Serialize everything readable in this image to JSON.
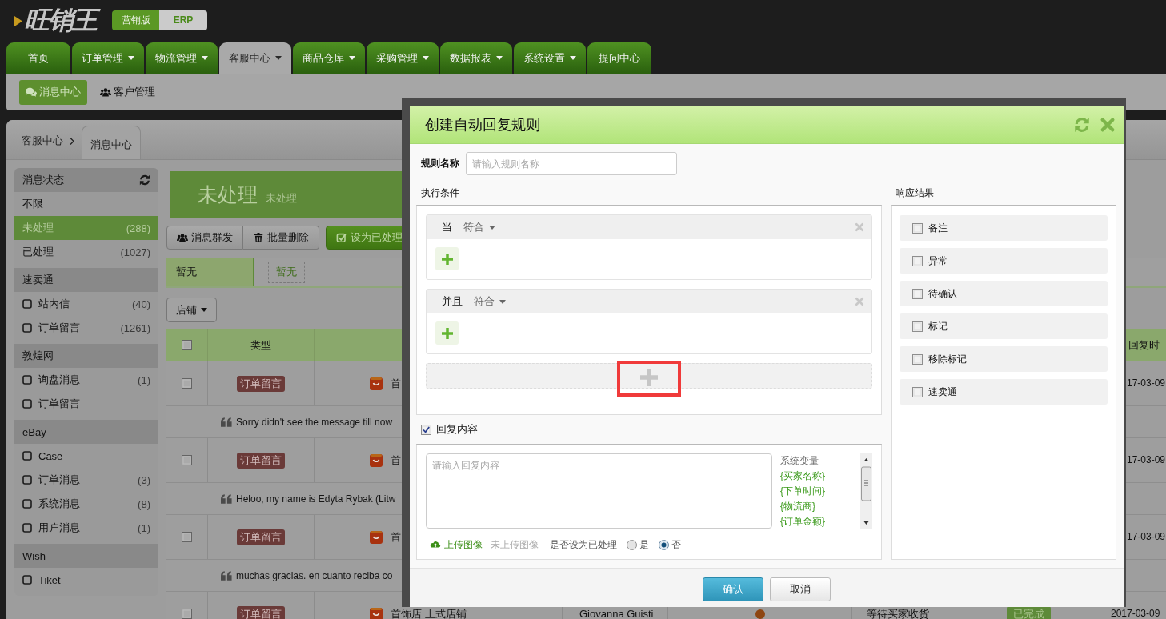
{
  "header": {
    "logo": "旺销王",
    "edition_switch": [
      {
        "label": "营销版",
        "selected": false
      },
      {
        "label": "ERP",
        "selected": true
      }
    ]
  },
  "nav_tabs": [
    {
      "label": "首页",
      "dropdown": false,
      "selected": false
    },
    {
      "label": "订单管理",
      "dropdown": true,
      "selected": false
    },
    {
      "label": "物流管理",
      "dropdown": true,
      "selected": false
    },
    {
      "label": "客服中心",
      "dropdown": true,
      "selected": true
    },
    {
      "label": "商品仓库",
      "dropdown": true,
      "selected": false
    },
    {
      "label": "采购管理",
      "dropdown": true,
      "selected": false
    },
    {
      "label": "数据报表",
      "dropdown": true,
      "selected": false
    },
    {
      "label": "系统设置",
      "dropdown": true,
      "selected": false
    },
    {
      "label": "提问中心",
      "dropdown": false,
      "selected": false
    }
  ],
  "sub_nav": [
    {
      "label": "消息中心",
      "selected": true
    },
    {
      "label": "客户管理",
      "selected": false
    }
  ],
  "breadcrumb": {
    "parent": "客服中心",
    "current_tab": "消息中心"
  },
  "sidebar": {
    "groups": [
      {
        "kind": "status",
        "title": "消息状态",
        "items": [
          {
            "label": "不限",
            "selected": false
          },
          {
            "label": "未处理",
            "count": "(288)",
            "selected": true
          },
          {
            "label": "已处理",
            "count": "(1027)",
            "selected": false
          }
        ]
      },
      {
        "kind": "platform",
        "title": "速卖通",
        "items": [
          {
            "label": "站内信",
            "count": "(40)",
            "checked": false
          },
          {
            "label": "订单留言",
            "count": "(1261)",
            "checked": false
          }
        ]
      },
      {
        "kind": "platform",
        "title": "敦煌网",
        "items": [
          {
            "label": "询盘消息",
            "count": "(1)",
            "checked": false
          },
          {
            "label": "订单留言",
            "checked": false
          }
        ]
      },
      {
        "kind": "platform",
        "title": "eBay",
        "items": [
          {
            "label": "Case",
            "checked": false
          },
          {
            "label": "订单消息",
            "count": "(3)",
            "checked": false
          },
          {
            "label": "系统消息",
            "count": "(8)",
            "checked": false
          },
          {
            "label": "用户消息",
            "count": "(1)",
            "checked": false
          }
        ]
      },
      {
        "kind": "platform",
        "title": "Wish",
        "items": [
          {
            "label": "Tiket",
            "checked": false
          }
        ]
      }
    ]
  },
  "banner": {
    "title": "未处理",
    "subtitle": "未处理"
  },
  "toolbar": [
    {
      "label": "消息群发",
      "kind": "default"
    },
    {
      "label": "批量删除",
      "kind": "default"
    },
    {
      "label": "设为已处理",
      "kind": "primary"
    }
  ],
  "filter": {
    "label": "暂无",
    "tag": "暂无"
  },
  "shop_dropdown": "店铺",
  "table": {
    "header_checked": false,
    "type_header": "类型",
    "last_header": "回复时",
    "rows": [
      {
        "kind": "order",
        "checked": false,
        "type": "订单留言",
        "shop": "首",
        "date": "17-03-09"
      },
      {
        "kind": "message",
        "text": "Sorry didn't see the message till now"
      },
      {
        "kind": "order",
        "checked": false,
        "type": "订单留言",
        "shop": "首",
        "date": "17-03-09"
      },
      {
        "kind": "message",
        "text": "Heloo, my name is Edyta Rybak (Litw"
      },
      {
        "kind": "order",
        "checked": false,
        "type": "订单留言",
        "shop": "首",
        "date": "17-03-09"
      },
      {
        "kind": "message",
        "text": "muchas gracias. en cuanto reciba co"
      },
      {
        "kind": "order",
        "checked": false,
        "type": "订单留言",
        "shop": "首饰店 上式店铺",
        "buyer": "Giovanna Guisti",
        "status": "等待买家收货",
        "result": "已完成",
        "date": "2017-03-09"
      }
    ]
  },
  "dialog": {
    "title": "创建自动回复规则",
    "rule_name": {
      "label": "规则名称",
      "placeholder": "请输入规则名称"
    },
    "conditions": {
      "label": "执行条件",
      "groups": [
        {
          "connector": "当",
          "match": "符合"
        },
        {
          "connector": "并且",
          "match": "符合"
        }
      ]
    },
    "results": {
      "label": "响应结果",
      "options": [
        {
          "label": "备注",
          "checked": false
        },
        {
          "label": "异常",
          "checked": false
        },
        {
          "label": "待确认",
          "checked": false
        },
        {
          "label": "标记",
          "checked": false
        },
        {
          "label": "移除标记",
          "checked": false
        },
        {
          "label": "速卖通",
          "checked": false
        }
      ]
    },
    "reply": {
      "label": "回复内容",
      "checked": true,
      "placeholder": "请输入回复内容",
      "variables_title": "系统变量",
      "variables": [
        "{买家名称}",
        "{下单时间}",
        "{物流商}",
        "{订单金额}"
      ],
      "upload_link": "上传图像",
      "upload_status": "未上传图像",
      "processed_label": "是否设为已处理",
      "processed_options": [
        {
          "label": "是",
          "selected": false
        },
        {
          "label": "否",
          "selected": true
        }
      ]
    },
    "buttons": [
      {
        "label": "确认",
        "kind": "primary"
      },
      {
        "label": "取消",
        "kind": "default"
      }
    ]
  }
}
